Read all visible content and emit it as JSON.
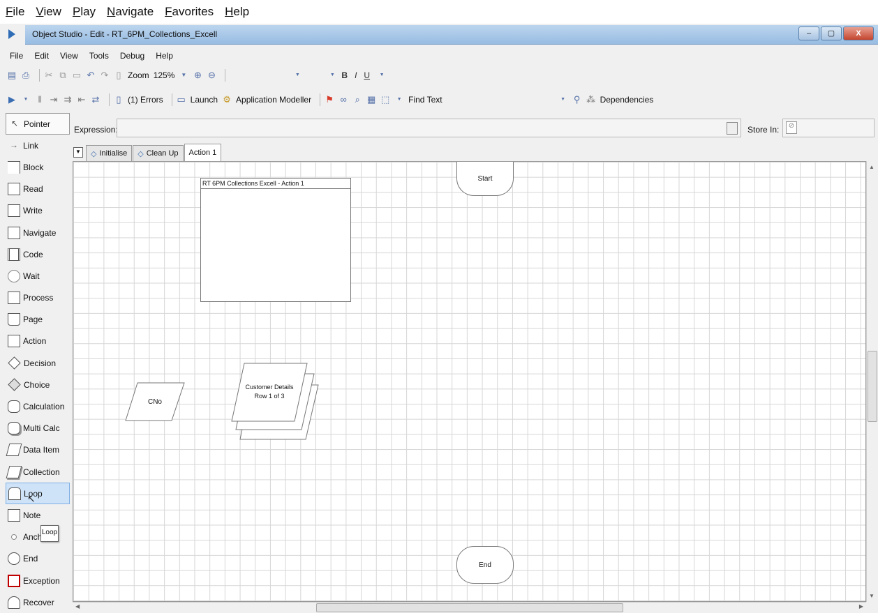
{
  "outer_menu": [
    "File",
    "View",
    "Play",
    "Navigate",
    "Favorites",
    "Help"
  ],
  "title": "Object Studio - Edit - RT_6PM_Collections_Excell",
  "window_controls": {
    "minimize": "–",
    "maximize": "▢",
    "close": "X"
  },
  "app_menu": [
    "File",
    "Edit",
    "View",
    "Tools",
    "Debug",
    "Help"
  ],
  "toolbar1": {
    "zoom_label": "Zoom",
    "zoom_value": "125%",
    "bold": "B",
    "italic": "I",
    "underline": "U"
  },
  "toolbar2": {
    "errors": "(1) Errors",
    "launch": "Launch",
    "app_modeller": "Application Modeller",
    "find_text": "Find Text",
    "dependencies": "Dependencies"
  },
  "palette": [
    "Pointer",
    "Link",
    "Block",
    "Read",
    "Write",
    "Navigate",
    "Code",
    "Wait",
    "Process",
    "Page",
    "Action",
    "Decision",
    "Choice",
    "Calculation",
    "Multi Calc",
    "Data Item",
    "Collection",
    "Loop",
    "Note",
    "Anchor",
    "End",
    "Exception",
    "Recover"
  ],
  "expression_label": "Expression:",
  "store_in_label": "Store In:",
  "tabs": [
    "Initialise",
    "Clean Up",
    "Action 1"
  ],
  "canvas": {
    "start_label": "Start",
    "end_label": "End",
    "page_description": "RT 6PM Collections Excell - Action 1",
    "data_item_label": "CNo",
    "collection_name": "Customer Details",
    "collection_row": "Row 1 of 3"
  },
  "tooltip": "Loop",
  "colors": {
    "selection": "#cfe3f8",
    "exception": "#c00000",
    "grid": "#d6d6d6",
    "titlebar": "#98bce2"
  }
}
